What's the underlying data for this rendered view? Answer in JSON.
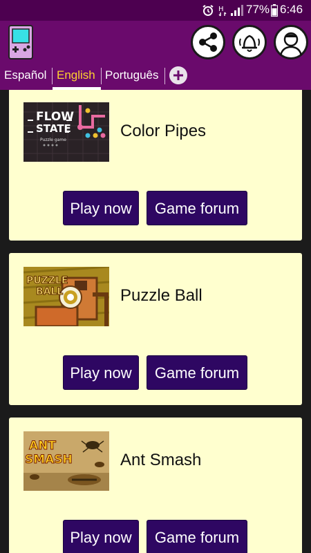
{
  "status_bar": {
    "battery": "77%",
    "time": "6:46"
  },
  "header": {
    "logo_icon": "handheld-console-icon",
    "share_icon": "share-icon",
    "notification_icon": "bell-ringing-icon",
    "profile_icon": "user-avatar-icon"
  },
  "languages": {
    "tabs": [
      {
        "label": "Español"
      },
      {
        "label": "English"
      },
      {
        "label": "Português"
      }
    ],
    "active": "English",
    "add_icon": "plus-circle-icon"
  },
  "games": [
    {
      "title": "Color Pipes",
      "thumb_text": [
        "FLOW",
        "STATE",
        "Puzzle game"
      ],
      "play_label": "Play now",
      "forum_label": "Game forum"
    },
    {
      "title": "Puzzle Ball",
      "thumb_text": [
        "PUZZLE",
        "BALL"
      ],
      "play_label": "Play now",
      "forum_label": "Game forum"
    },
    {
      "title": "Ant Smash",
      "thumb_text": [
        "ANT",
        "SMASH"
      ],
      "play_label": "Play now",
      "forum_label": "Game forum"
    }
  ],
  "colors": {
    "status_bar": "#4d0050",
    "app_bar": "#6a0a6c",
    "card_bg": "#ffffcf",
    "button_bg": "#2e0762",
    "active_tab": "#ffd230"
  }
}
